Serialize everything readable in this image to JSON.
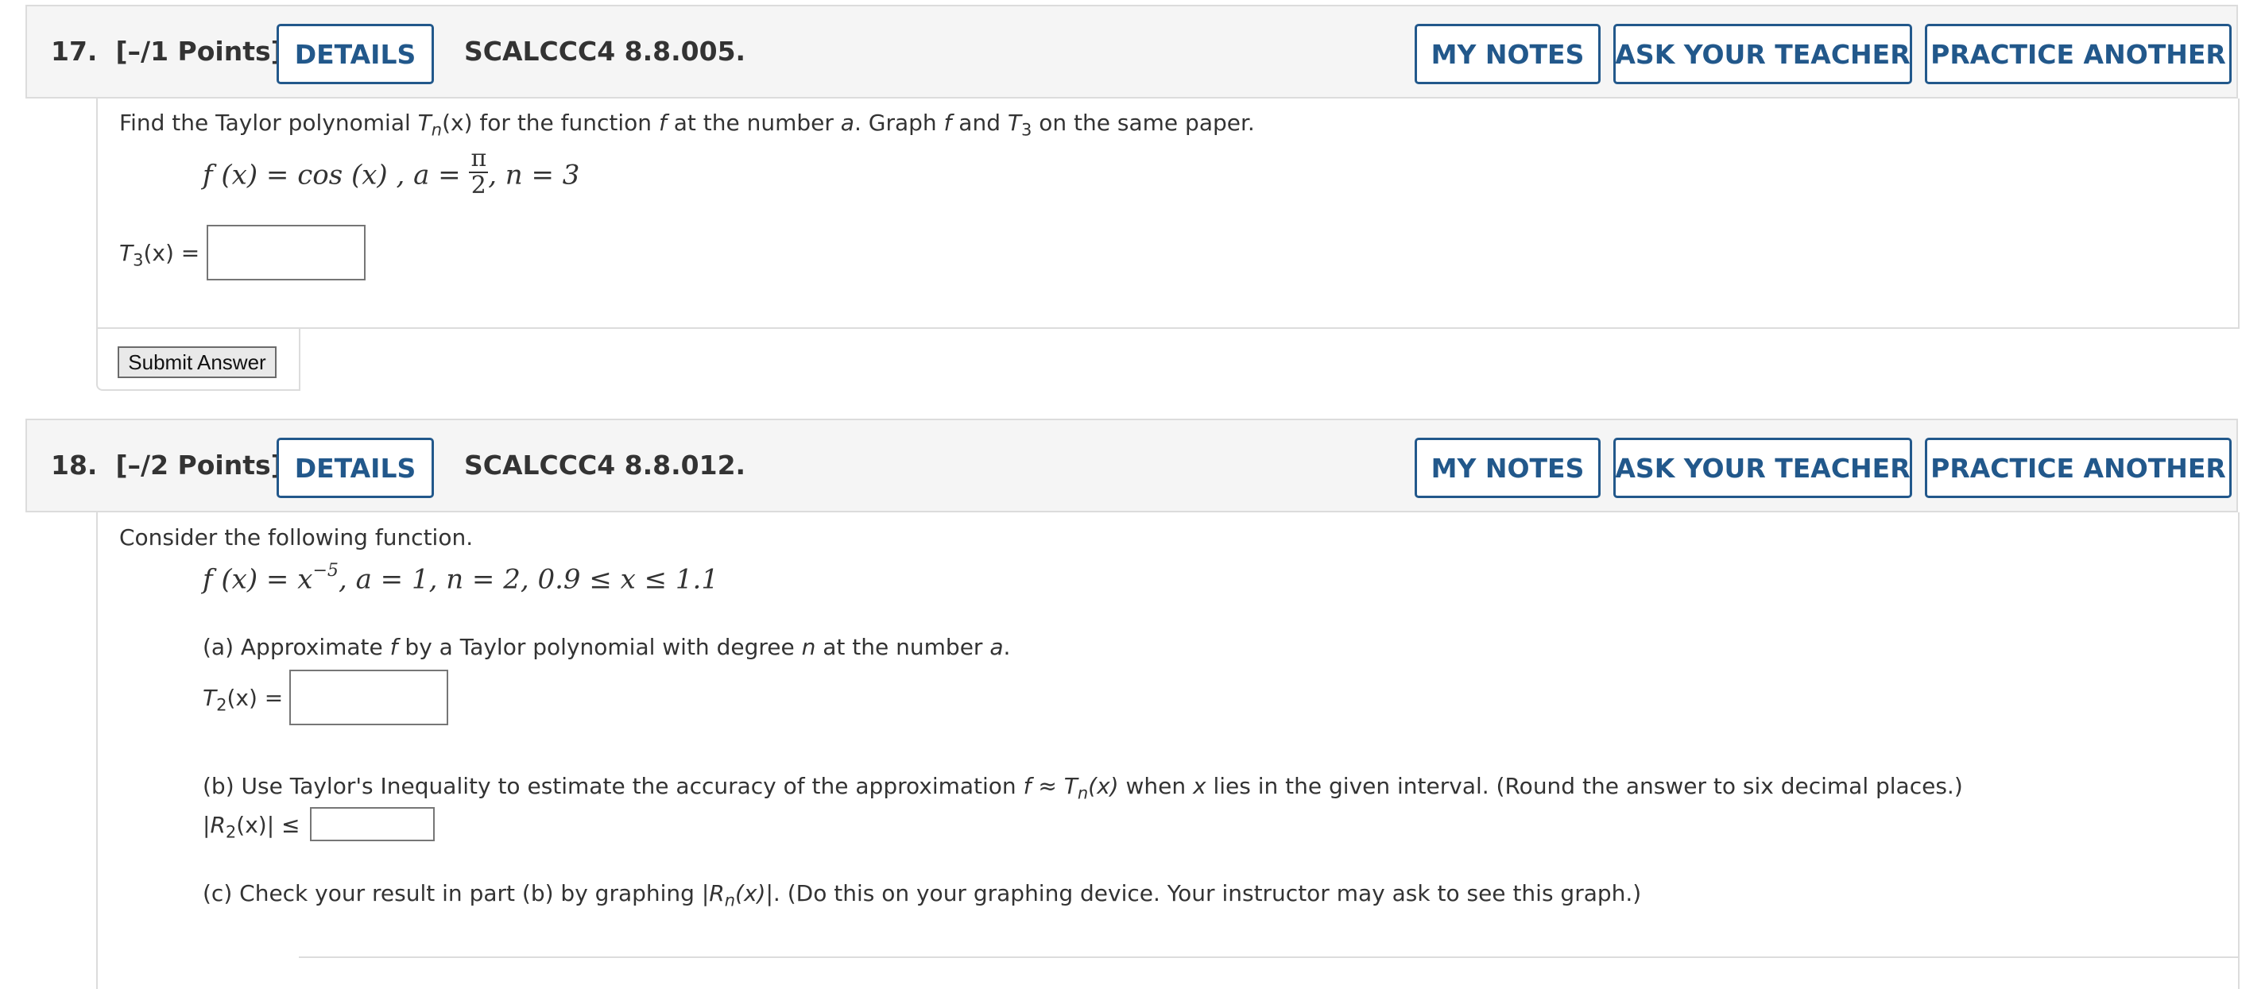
{
  "questions": [
    {
      "number": "17.",
      "points": "[–/1 Points]",
      "details": "DETAILS",
      "code": "SCALCCC4 8.8.005.",
      "my_notes": "MY NOTES",
      "ask_teacher": "ASK YOUR TEACHER",
      "practice": "PRACTICE ANOTHER",
      "prompt": {
        "p1": "Find the Taylor polynomial ",
        "T": "T",
        "n": "n",
        "x_paren": "(x)",
        "p2": " for the function ",
        "f": "f",
        "p3": " at the number ",
        "a": "a",
        "p4": ". Graph ",
        "f2": "f",
        "p5": " and ",
        "T3": "T",
        "three": "3",
        "p6": " on the same paper."
      },
      "formula": {
        "left": "f (x) = cos (x) , a = ",
        "pi": "π",
        "two": "2",
        "right": ", n = 3"
      },
      "answer_label": {
        "T": "T",
        "sub": "3",
        "rest": "(x) ="
      },
      "answer_value": "",
      "submit": "Submit Answer"
    },
    {
      "number": "18.",
      "points": "[–/2 Points]",
      "details": "DETAILS",
      "code": "SCALCCC4 8.8.012.",
      "my_notes": "MY NOTES",
      "ask_teacher": "ASK YOUR TEACHER",
      "practice": "PRACTICE ANOTHER",
      "intro": "Consider the following function.",
      "formula": {
        "left": "f (x) = x",
        "exp": "−5",
        "right": ", a = 1, n = 2, 0.9 ≤ x ≤ 1.1"
      },
      "part_a": {
        "p1": "(a) Approximate ",
        "f": "f",
        "p2": " by a Taylor polynomial with degree ",
        "n": "n",
        "p3": " at the number ",
        "a": "a",
        "p4": "."
      },
      "answer_a_label": {
        "T": "T",
        "sub": "2",
        "rest": "(x) ="
      },
      "answer_a_value": "",
      "part_b": {
        "p1": "(b) Use Taylor's Inequality to estimate the accuracy of the approximation ",
        "f": "f",
        "approx": " ≈ ",
        "T": "T",
        "n": "n",
        "x": "(x)",
        "p2": " when ",
        "xv": "x",
        "p3": " lies in the given interval. (Round the answer to six decimal places.)"
      },
      "answer_b_label": {
        "open": "|",
        "R": "R",
        "sub": "2",
        "rest": "(x)| ≤"
      },
      "answer_b_value": "",
      "part_c": {
        "p1": "(c) Check your result in part (b) by graphing |",
        "R": "R",
        "n": "n",
        "p2": "(x)",
        "p3": "|. (Do this on your graphing device. Your instructor may ask to see this graph.)"
      }
    }
  ]
}
